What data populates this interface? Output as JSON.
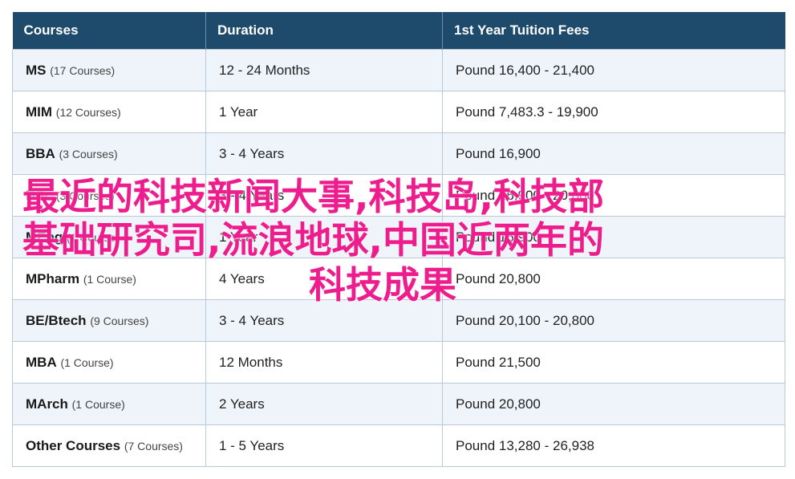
{
  "table": {
    "headers": [
      "Courses",
      "Duration",
      "1st Year Tuition Fees"
    ],
    "rows": [
      {
        "name": "MS",
        "count": "(17 Courses)",
        "duration": "12 - 24 Months",
        "fee": "Pound 16,400 - 21,400"
      },
      {
        "name": "MIM",
        "count": "(12 Courses)",
        "duration": "1 Year",
        "fee": "Pound 7,483.3 - 19,900"
      },
      {
        "name": "BBA",
        "count": "(3 Courses)",
        "duration": "3 - 4 Years",
        "fee": "Pound 16,900"
      },
      {
        "name": "BSc",
        "count": "(3 Courses)",
        "duration": "3 - 4 Years",
        "fee": "Pound 16,900 - 20,800"
      },
      {
        "name": "MEng",
        "count": "(1 Course)",
        "duration": "1 Year",
        "fee": "Pound 16,900"
      },
      {
        "name": "MPharm",
        "count": "(1 Course)",
        "duration": "4 Years",
        "fee": "Pound 20,800"
      },
      {
        "name": "BE/Btech",
        "count": "(9 Courses)",
        "duration": "3 - 4 Years",
        "fee": "Pound 20,100 - 20,800"
      },
      {
        "name": "MBA",
        "count": "(1 Course)",
        "duration": "12 Months",
        "fee": "Pound 21,500"
      },
      {
        "name": "MArch",
        "count": "(1 Course)",
        "duration": "2 Years",
        "fee": "Pound 20,800"
      },
      {
        "name": "Other Courses",
        "count": "(7 Courses)",
        "duration": "1 - 5 Years",
        "fee": "Pound 13,280 - 26,938"
      }
    ]
  },
  "overlay": {
    "line1": "最近的科技新闻大事,科技岛,科技部",
    "line2": "基础研究司,流浪地球,中国近两年的",
    "line3": "科技成果"
  }
}
